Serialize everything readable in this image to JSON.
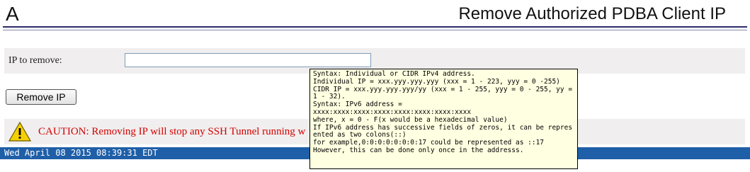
{
  "header": {
    "logo_text": "A",
    "title": "Remove Authorized PDBA Client IP"
  },
  "form": {
    "ip_label": "IP to remove:",
    "ip_value": "",
    "remove_button_label": "Remove IP"
  },
  "caution": {
    "icon": "warning-triangle-icon",
    "text": "CAUTION: Removing IP will stop any SSH Tunnel running w"
  },
  "tooltip": {
    "lines": [
      "Syntax: Individual or CIDR IPv4 address.",
      "Individual IP = xxx.yyy.yyy.yyy (xxx = 1 - 223, yyy = 0 -255)",
      "CIDR IP = xxx.yyy.yyy.yyy/yy (xxx = 1 - 255, yyy = 0 - 255, yy = 1 - 32).",
      "Syntax: IPv6 address =",
      "xxxx:xxxx:xxxx:xxxx:xxxx:xxxx:xxxx:xxxx",
      "where, x = 0 - F(x would be a hexadecimal value)",
      "If IPv6 address has successive fields of zeros, it can be represented as two colons(::)",
      "for example,0:0:0:0:0:0:0:17 could be represented as ::17",
      "However, this can be done only once in the addresss."
    ]
  },
  "status_bar": {
    "datetime": "Wed April 08 2015 08:39:31 EDT"
  },
  "colors": {
    "status_bar": "#1f5fa8",
    "caution_text": "#d40000",
    "tooltip_bg": "#ffffe1",
    "row_bg": "#f0eeee"
  }
}
